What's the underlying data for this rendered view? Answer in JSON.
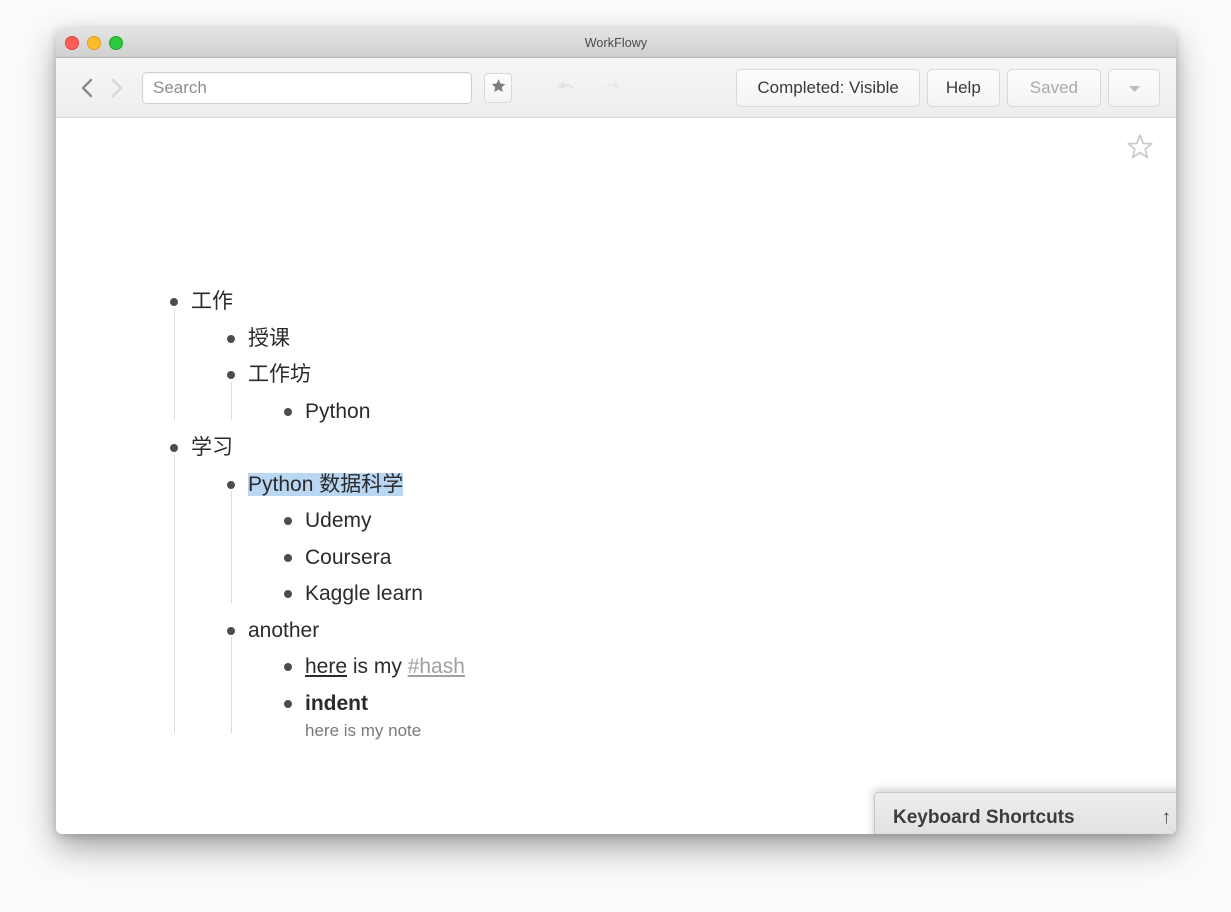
{
  "window": {
    "title": "WorkFlowy",
    "traffic_lights": [
      "close",
      "minimize",
      "maximize"
    ]
  },
  "toolbar": {
    "back_icon": "chevron-left-icon",
    "forward_icon": "chevron-right-icon",
    "search_placeholder": "Search",
    "search_value": "",
    "star_icon": "star-filled-icon",
    "undo_icon": "undo-arrow-icon",
    "redo_icon": "redo-arrow-icon",
    "completed_label": "Completed: Visible",
    "help_label": "Help",
    "saved_label": "Saved",
    "dropdown_icon": "chevron-down-icon"
  },
  "content": {
    "page_star_icon": "star-outline-icon"
  },
  "outline": [
    {
      "text": "工作",
      "level": 1,
      "children": [
        {
          "text": "授课",
          "level": 2,
          "children": []
        },
        {
          "text": "工作坊",
          "level": 2,
          "children": [
            {
              "text": "Python",
              "level": 3,
              "children": []
            }
          ]
        }
      ]
    },
    {
      "text": "学习",
      "level": 1,
      "children": [
        {
          "text": "Python 数据科学",
          "level": 2,
          "selected": true,
          "children": [
            {
              "text": "Udemy",
              "level": 3,
              "children": []
            },
            {
              "text": "Coursera",
              "level": 3,
              "children": []
            },
            {
              "text": "Kaggle learn",
              "level": 3,
              "children": []
            }
          ]
        },
        {
          "text": "another",
          "level": 2,
          "children": [
            {
              "level": 3,
              "rich": [
                {
                  "text": "here",
                  "style": "underline"
                },
                {
                  "text": " is my ",
                  "style": "plain"
                },
                {
                  "text": "#hash",
                  "style": "hashtag"
                }
              ],
              "children": []
            },
            {
              "text": "indent",
              "level": 3,
              "style": "bold",
              "note": "here is my note",
              "children": []
            }
          ]
        }
      ]
    }
  ],
  "keyboard_shortcuts": {
    "label": "Keyboard Shortcuts",
    "arrow": "↑"
  },
  "colors": {
    "selection_highlight": "#b9d6f2",
    "bullet": "#4d4d4d",
    "guide_line": "#dcdcdc",
    "note_text": "#7a7a7a",
    "hashtag": "#a0a0a0"
  }
}
